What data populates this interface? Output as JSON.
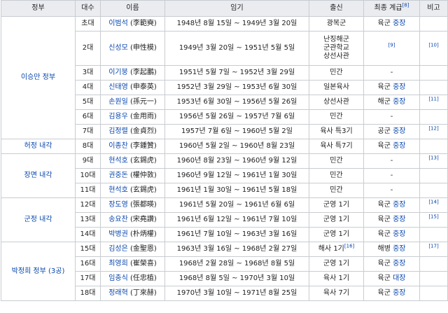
{
  "headers": {
    "gov": "정부",
    "order": "대수",
    "name": "이름",
    "term": "임기",
    "origin": "출신",
    "rank": "최종 계급",
    "rank_ref": "[8]",
    "note": "비고"
  },
  "governments": [
    {
      "label": "이승만 정부"
    },
    {
      "label": "허정 내각"
    },
    {
      "label": "장면 내각"
    },
    {
      "label": "군정 내각"
    },
    {
      "label": "박정희 정부 (3공)"
    }
  ],
  "rows": [
    {
      "order": "초대",
      "name": "이범석",
      "hanja": "(李範奭)",
      "term": "1948년 8월 15일 ~ 1949년 3월 20일",
      "origin": "광복군",
      "origin_ref": "",
      "branch": "육군",
      "rank": "중장",
      "note": ""
    },
    {
      "order": "2대",
      "name": "신성모",
      "hanja": "(申性模)",
      "term": "1949년 3월 20일 ~ 1951년 5월 5일",
      "origin_lines": [
        "난징해군",
        "군관학교",
        "상선사관"
      ],
      "origin_ref": "",
      "branch": "",
      "rank": "[9]",
      "note": "[10]"
    },
    {
      "order": "3대",
      "name": "이기붕",
      "hanja": "(李起鵬)",
      "term": "1951년 5월 7일 ~ 1952년 3월 29일",
      "origin": "민간",
      "origin_ref": "",
      "branch": "",
      "rank": "-",
      "note": ""
    },
    {
      "order": "4대",
      "name": "신태영",
      "hanja": "(申泰英)",
      "term": "1952년 3월 29일 ~ 1953년 6월 30일",
      "origin": "일본육사",
      "origin_ref": "",
      "branch": "육군",
      "rank": "중장",
      "note": ""
    },
    {
      "order": "5대",
      "name": "손원일",
      "hanja": "(孫元一)",
      "term": "1953년 6월 30일 ~ 1956년 5월 26일",
      "origin": "상선사관",
      "origin_ref": "",
      "branch": "해군",
      "rank": "중장",
      "note": "[11]"
    },
    {
      "order": "6대",
      "name": "김용우",
      "hanja": "(金用雨)",
      "term": "1956년 5월 26일 ~ 1957년 7월 6일",
      "origin": "민간",
      "origin_ref": "",
      "branch": "",
      "rank": "-",
      "note": ""
    },
    {
      "order": "7대",
      "name": "김정렬",
      "hanja": "(金貞烈)",
      "term": "1957년 7월 6일 ~ 1960년 5월 2일",
      "origin": "육사 특3기",
      "origin_ref": "",
      "branch": "공군",
      "rank": "중장",
      "note": "[12]"
    },
    {
      "order": "8대",
      "name": "이종찬",
      "hanja": "(李鍾贊)",
      "term": "1960년 5월 2일 ~ 1960년 8월 23일",
      "origin": "육사 특7기",
      "origin_ref": "",
      "branch": "육군",
      "rank": "중장",
      "note": ""
    },
    {
      "order": "9대",
      "name": "현석호",
      "hanja": "(玄錫虎)",
      "term": "1960년 8월 23일 ~ 1960년 9월 12일",
      "origin": "민간",
      "origin_ref": "",
      "branch": "",
      "rank": "-",
      "note": "[13]"
    },
    {
      "order": "10대",
      "name": "권중돈",
      "hanja": "(權仲敦)",
      "term": "1960년 9월 12일 ~ 1961년 1월 30일",
      "origin": "민간",
      "origin_ref": "",
      "branch": "",
      "rank": "-",
      "note": ""
    },
    {
      "order": "11대",
      "name": "현석호",
      "hanja": "(玄錫虎)",
      "term": "1961년 1월 30일 ~ 1961년 5월 18일",
      "origin": "민간",
      "origin_ref": "",
      "branch": "",
      "rank": "-",
      "note": ""
    },
    {
      "order": "12대",
      "name": "장도영",
      "hanja": "(張都暎)",
      "term": "1961년 5월 20일 ~ 1961년 6월 6일",
      "origin": "군영 1기",
      "origin_ref": "",
      "branch": "육군",
      "rank": "중장",
      "note": "[14]"
    },
    {
      "order": "13대",
      "name": "송요찬",
      "hanja": "(宋堯讚)",
      "term": "1961년 6월 12일 ~ 1961년 7월 10일",
      "origin": "군영 1기",
      "origin_ref": "",
      "branch": "육군",
      "rank": "중장",
      "note": "[15]"
    },
    {
      "order": "14대",
      "name": "박병권",
      "hanja": "(朴炳權)",
      "term": "1961년 7월 10일 ~ 1963년 3월 16일",
      "origin": "군영 1기",
      "origin_ref": "",
      "branch": "육군",
      "rank": "중장",
      "note": ""
    },
    {
      "order": "15대",
      "name": "김성은",
      "hanja": "(金聖恩)",
      "term": "1963년 3월 16일 ~ 1968년 2월 27일",
      "origin": "해사 1기",
      "origin_ref": "[16]",
      "branch": "해병",
      "rank": "중장",
      "note": "[17]"
    },
    {
      "order": "16대",
      "name": "최영희",
      "hanja": "(崔榮喜)",
      "term": "1968년 2월 28일 ~ 1968년 8월 5일",
      "origin": "군영 1기",
      "origin_ref": "",
      "branch": "육군",
      "rank": "중장",
      "note": ""
    },
    {
      "order": "17대",
      "name": "임충식",
      "hanja": "(任忠植)",
      "term": "1968년 8월 5일 ~ 1970년 3월 10일",
      "origin": "육사 1기",
      "origin_ref": "",
      "branch": "육군",
      "rank": "대장",
      "note": ""
    },
    {
      "order": "18대",
      "name": "정래혁",
      "hanja": "(丁來赫)",
      "term": "1970년 3월 10일 ~ 1971년 8월 25일",
      "origin": "육사 7기",
      "origin_ref": "",
      "branch": "육군",
      "rank": "중장",
      "note": ""
    }
  ]
}
